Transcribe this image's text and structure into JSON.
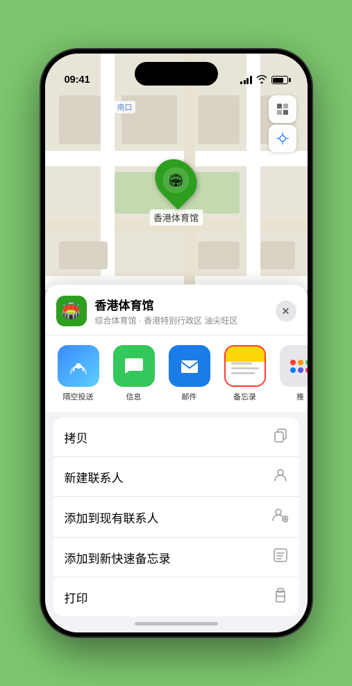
{
  "status": {
    "time": "09:41",
    "signal_label": "signal",
    "wifi_label": "wifi",
    "battery_label": "battery"
  },
  "map": {
    "label": "南口",
    "map_type_label": "地图",
    "location_label": "定位"
  },
  "location": {
    "name": "香港体育馆",
    "subtitle": "综合体育馆 · 香港特别行政区 油尖旺区",
    "icon": "🏟️",
    "close_label": "✕"
  },
  "share_items": [
    {
      "id": "airdrop",
      "label": "隔空投送",
      "style": "airdrop"
    },
    {
      "id": "messages",
      "label": "信息",
      "style": "messages"
    },
    {
      "id": "mail",
      "label": "邮件",
      "style": "mail"
    },
    {
      "id": "notes",
      "label": "备忘录",
      "style": "notes",
      "selected": true
    },
    {
      "id": "more",
      "label": "推",
      "style": "more"
    }
  ],
  "actions": [
    {
      "id": "copy",
      "label": "拷贝",
      "icon": "📋"
    },
    {
      "id": "new-contact",
      "label": "新建联系人",
      "icon": "👤"
    },
    {
      "id": "add-existing",
      "label": "添加到现有联系人",
      "icon": "👤"
    },
    {
      "id": "add-quicknote",
      "label": "添加到新快速备忘录",
      "icon": "📝"
    },
    {
      "id": "print",
      "label": "打印",
      "icon": "🖨️"
    }
  ]
}
